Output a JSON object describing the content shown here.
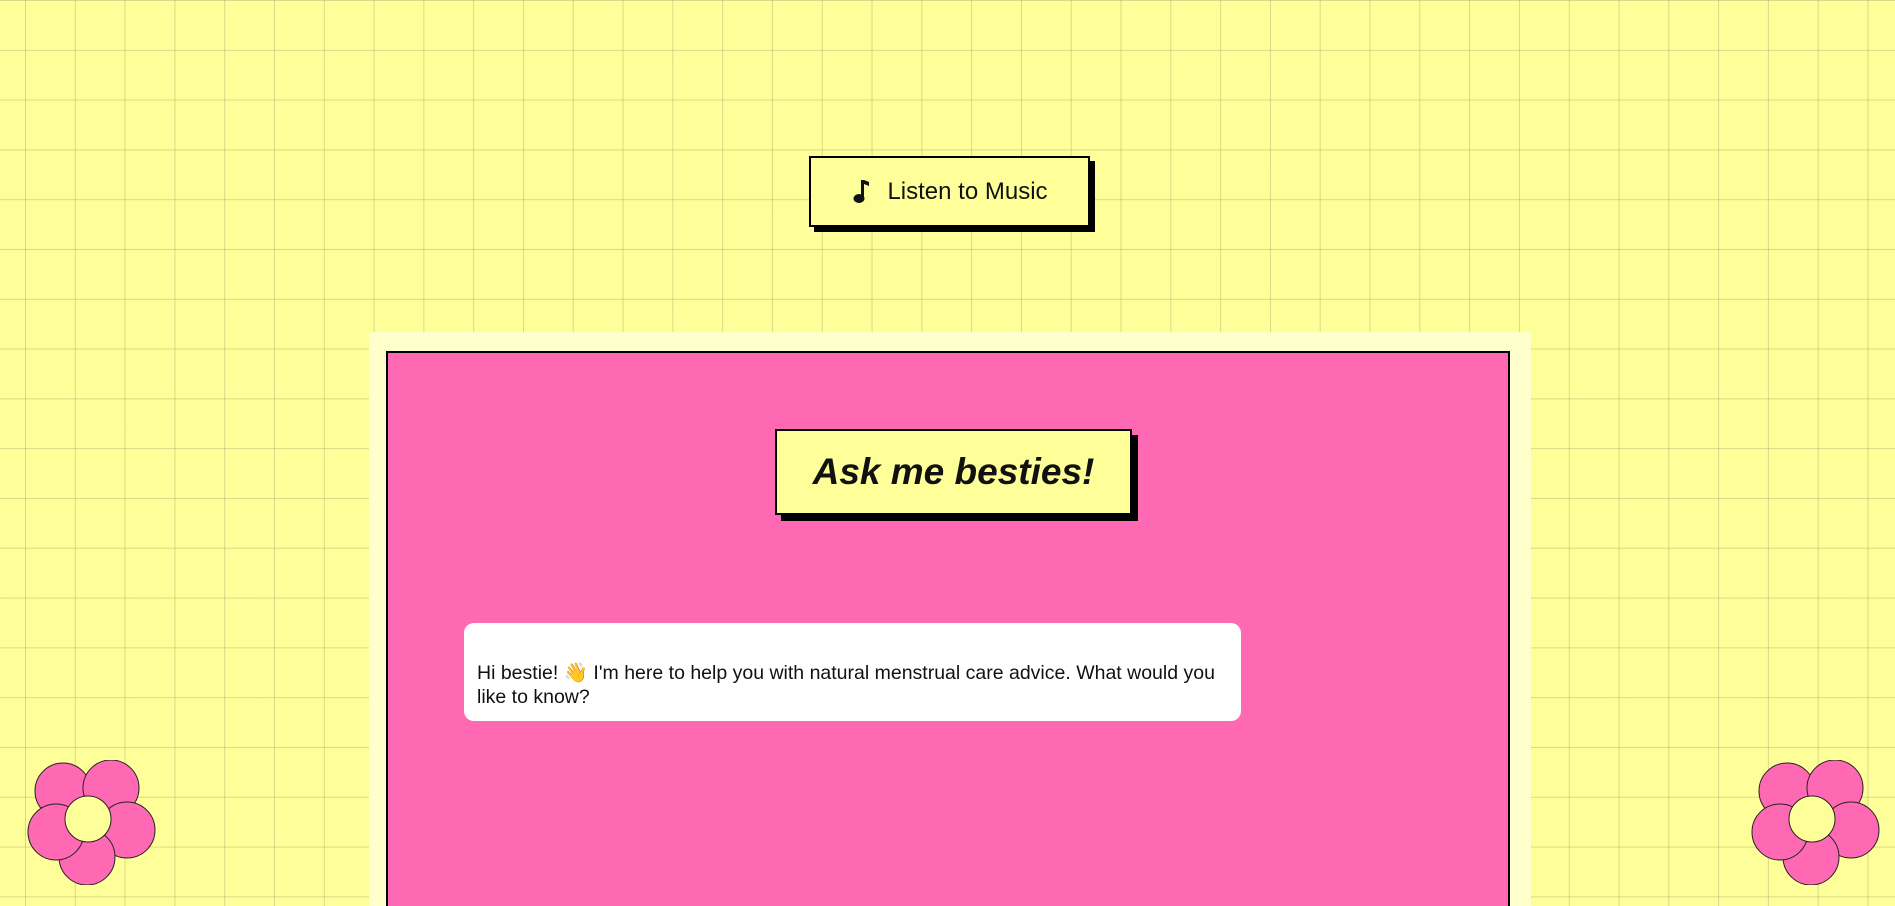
{
  "music_button": {
    "label": "Listen to Music",
    "icon": "music-note-icon"
  },
  "chat": {
    "title": "Ask me besties!",
    "messages": [
      {
        "sender": "bot",
        "text": "Hi bestie! 👋 I'm here to help you with natural menstrual care advice. What would you like to know?"
      }
    ]
  },
  "decorations": {
    "flower_left": "flower-icon",
    "flower_right": "flower-icon"
  },
  "colors": {
    "background": "#ffff99",
    "chat_background": "#ff69b4",
    "flower_petal": "#ff69b4",
    "flower_center": "#ffff99",
    "bubble": "#ffffff"
  }
}
